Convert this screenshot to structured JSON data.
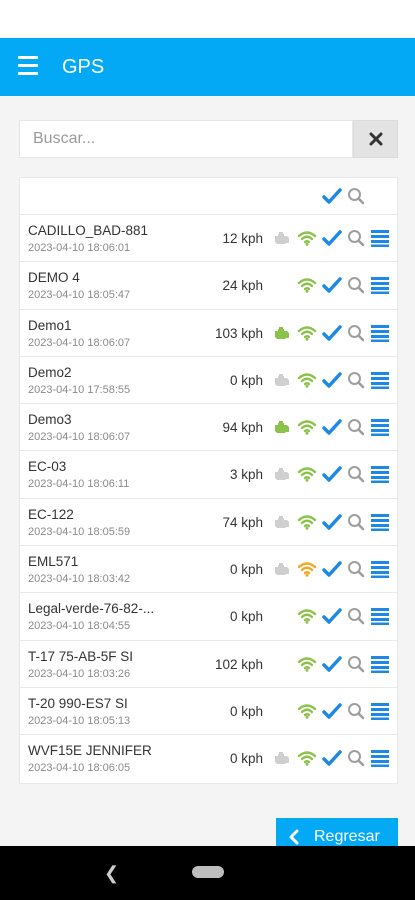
{
  "app": {
    "title": "GPS"
  },
  "search": {
    "placeholder": "Buscar..."
  },
  "colors": {
    "accent": "#03a9f4",
    "green": "#8bc34a",
    "orange": "#f5a623",
    "gray": "#cfcfcf",
    "check": "#1e88e5"
  },
  "vehicles": [
    {
      "name": "CADILLO_BAD-881",
      "time": "2023-04-10 18:06:01",
      "speed": "12 kph",
      "engine": "gray",
      "wifi": "green"
    },
    {
      "name": "DEMO 4",
      "time": "2023-04-10 18:05:47",
      "speed": "24 kph",
      "engine": "none",
      "wifi": "green"
    },
    {
      "name": "Demo1",
      "time": "2023-04-10 18:06:07",
      "speed": "103 kph",
      "engine": "green",
      "wifi": "green"
    },
    {
      "name": "Demo2",
      "time": "2023-04-10 17:58:55",
      "speed": "0 kph",
      "engine": "gray",
      "wifi": "green"
    },
    {
      "name": "Demo3",
      "time": "2023-04-10 18:06:07",
      "speed": "94 kph",
      "engine": "green",
      "wifi": "green"
    },
    {
      "name": "EC-03",
      "time": "2023-04-10 18:06:11",
      "speed": "3 kph",
      "engine": "gray",
      "wifi": "green"
    },
    {
      "name": "EC-122",
      "time": "2023-04-10 18:05:59",
      "speed": "74 kph",
      "engine": "gray",
      "wifi": "green"
    },
    {
      "name": "EML571",
      "time": "2023-04-10 18:03:42",
      "speed": "0 kph",
      "engine": "gray",
      "wifi": "orange"
    },
    {
      "name": "Legal-verde-76-82-...",
      "time": "2023-04-10 18:04:55",
      "speed": "0 kph",
      "engine": "none",
      "wifi": "green"
    },
    {
      "name": "T-17 75-AB-5F SI",
      "time": "2023-04-10 18:03:26",
      "speed": "102 kph",
      "engine": "none",
      "wifi": "green"
    },
    {
      "name": "T-20 990-ES7 SI",
      "time": "2023-04-10 18:05:13",
      "speed": "0 kph",
      "engine": "none",
      "wifi": "green"
    },
    {
      "name": "WVF15E JENNIFER",
      "time": "2023-04-10 18:06:05",
      "speed": "0 kph",
      "engine": "gray",
      "wifi": "green"
    }
  ],
  "footer": {
    "back_label": "Regresar"
  }
}
